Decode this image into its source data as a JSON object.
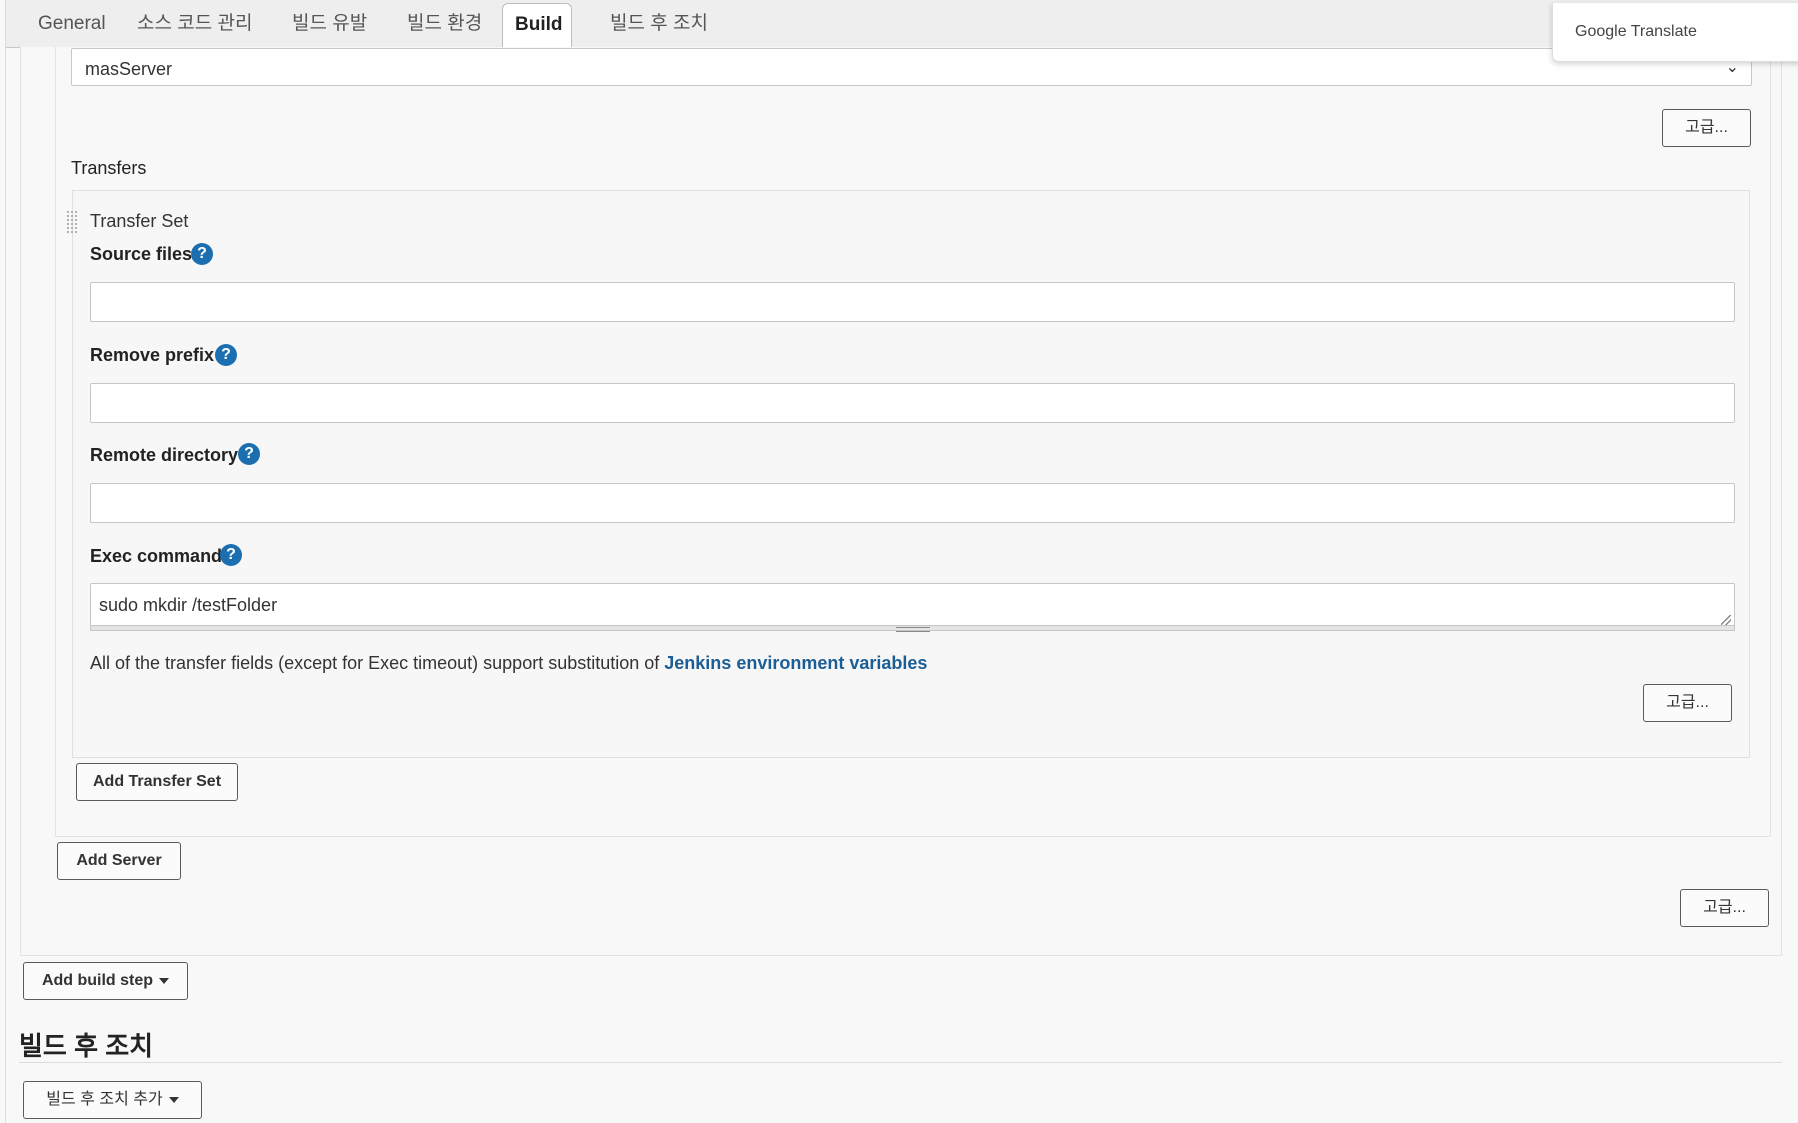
{
  "tabs": [
    {
      "label": "General",
      "active": false
    },
    {
      "label": "소스 코드 관리",
      "active": false
    },
    {
      "label": "빌드 유발",
      "active": false
    },
    {
      "label": "빌드 환경",
      "active": false
    },
    {
      "label": "Build",
      "active": true
    },
    {
      "label": "빌드 후 조치",
      "active": false
    }
  ],
  "translate_popup": {
    "brand": "Google",
    "product": "Translate"
  },
  "server": {
    "selected": "masServer",
    "advanced_label": "고급..."
  },
  "transfers": {
    "heading": "Transfers",
    "set_title": "Transfer Set",
    "fields": {
      "source_files": {
        "label": "Source files",
        "value": ""
      },
      "remove_prefix": {
        "label": "Remove prefix",
        "value": ""
      },
      "remote_directory": {
        "label": "Remote directory",
        "value": ""
      },
      "exec_command": {
        "label": "Exec command",
        "value": "sudo mkdir /testFolder"
      }
    },
    "note_prefix": "All of the transfer fields (except for Exec timeout) support substitution of ",
    "note_link": "Jenkins environment variables",
    "advanced_label": "고급...",
    "add_transfer_set": "Add Transfer Set"
  },
  "add_server": "Add Server",
  "build_advanced_label": "고급...",
  "add_build_step": "Add build step",
  "post_build": {
    "title": "빌드 후 조치",
    "add_label": "빌드 후 조치 추가"
  },
  "help_glyph": "?",
  "colors": {
    "help": "#1b6fb1",
    "link": "#1b5e96"
  }
}
